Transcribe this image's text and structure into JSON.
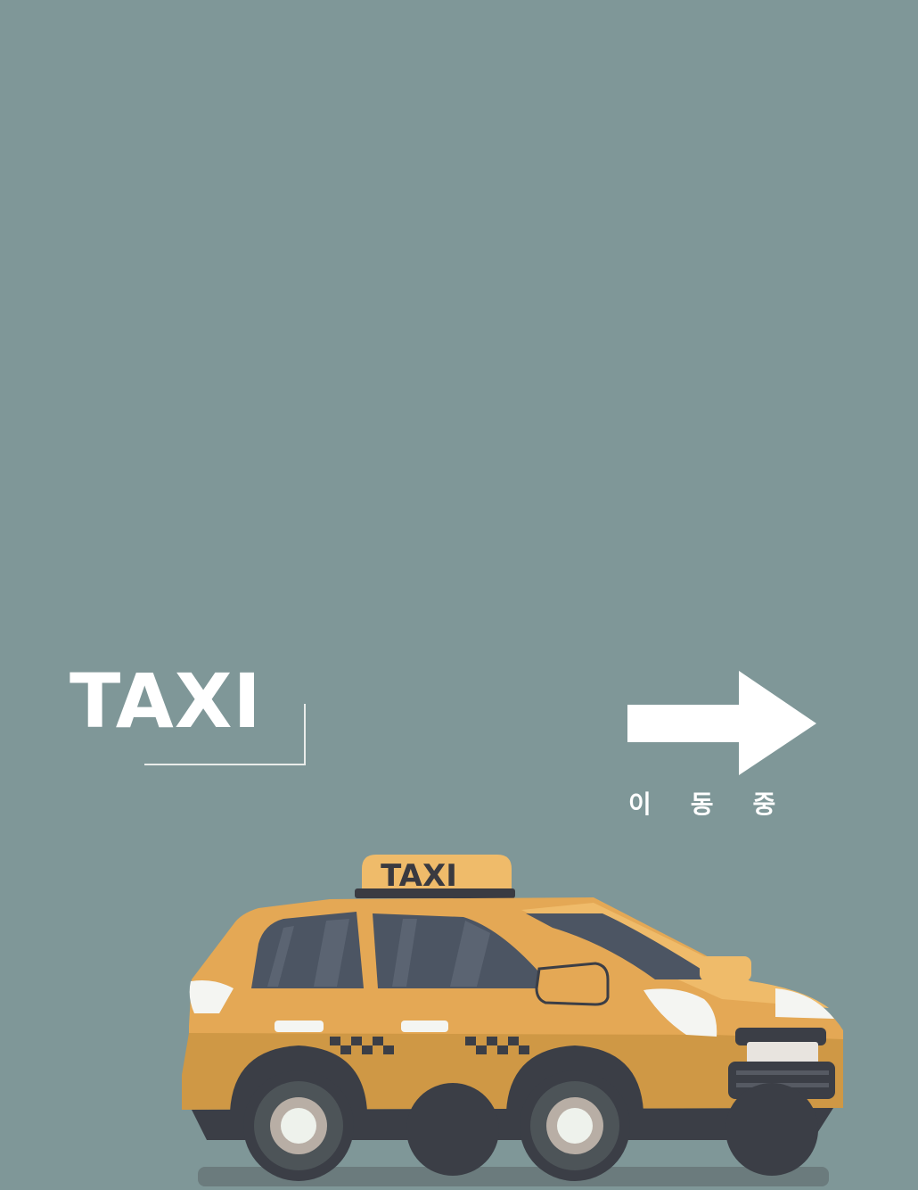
{
  "screen": {
    "background": "#7f9798"
  },
  "header": {
    "title": "TAXI"
  },
  "direction": {
    "icon": "right-arrow-icon",
    "status_label": "이동중"
  },
  "illustration": {
    "name": "taxi-car",
    "roof_sign_text": "TAXI",
    "body_color": "#e4a855",
    "body_shadow_color": "#cf9845",
    "window_color": "#4c5563",
    "tire_color": "#3b3e46"
  }
}
